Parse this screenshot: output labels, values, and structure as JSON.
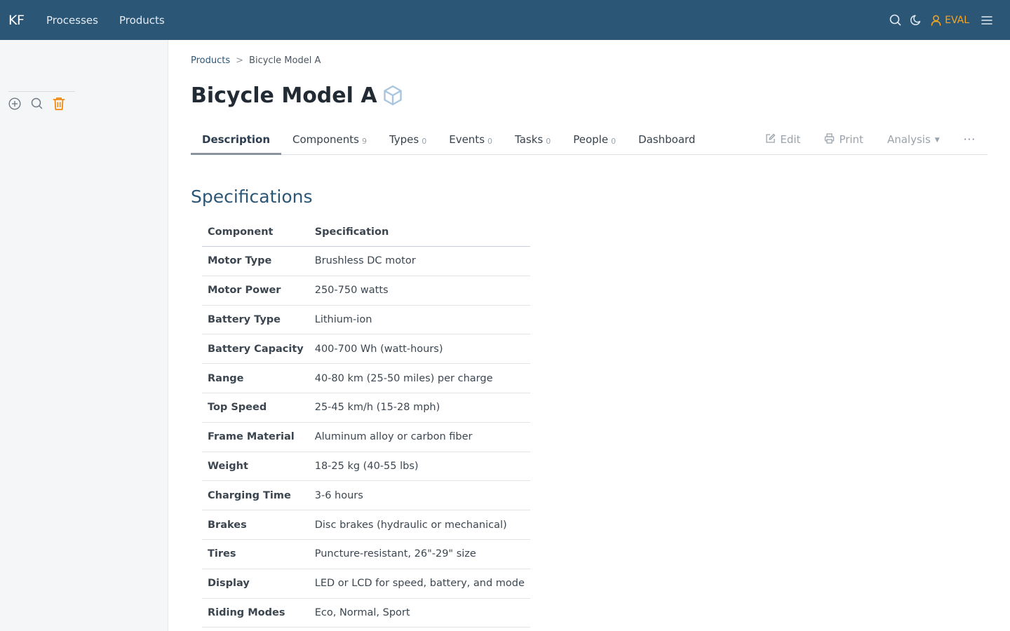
{
  "navbar": {
    "brand": "KF",
    "links": [
      "Processes",
      "Products"
    ],
    "user_label": "EVAL",
    "icons": [
      "search-icon",
      "moon-icon",
      "user-icon",
      "hamburger-icon"
    ],
    "color": "#2c5676",
    "user_color": "#f5a623"
  },
  "sidebar": {
    "buttons": [
      "add-circle-icon",
      "search-icon",
      "trash-icon"
    ]
  },
  "breadcrumb": {
    "parent": "Products",
    "separator": ">",
    "current": "Bicycle Model A"
  },
  "page": {
    "title": "Bicycle Model A",
    "title_icon": "cube-icon"
  },
  "tabs": [
    {
      "label": "Description",
      "count": ""
    },
    {
      "label": "Components",
      "count": "9"
    },
    {
      "label": "Types",
      "count": "0"
    },
    {
      "label": "Events",
      "count": "0"
    },
    {
      "label": "Tasks",
      "count": "0"
    },
    {
      "label": "People",
      "count": "0"
    },
    {
      "label": "Dashboard",
      "count": ""
    }
  ],
  "actions": {
    "edit": "Edit",
    "print": "Print",
    "analysis": "Analysis",
    "more": "···"
  },
  "specifications": {
    "heading": "Specifications",
    "columns": [
      "Component",
      "Specification"
    ],
    "rows": [
      {
        "component": "Motor Type",
        "spec": "Brushless DC motor"
      },
      {
        "component": "Motor Power",
        "spec": "250-750 watts"
      },
      {
        "component": "Battery Type",
        "spec": "Lithium-ion"
      },
      {
        "component": "Battery Capacity",
        "spec": "400-700 Wh (watt-hours)"
      },
      {
        "component": "Range",
        "spec": "40-80 km (25-50 miles) per charge"
      },
      {
        "component": "Top Speed",
        "spec": "25-45 km/h (15-28 mph)"
      },
      {
        "component": "Frame Material",
        "spec": "Aluminum alloy or carbon fiber"
      },
      {
        "component": "Weight",
        "spec": "18-25 kg (40-55 lbs)"
      },
      {
        "component": "Charging Time",
        "spec": "3-6 hours"
      },
      {
        "component": "Brakes",
        "spec": "Disc brakes (hydraulic or mechanical)"
      },
      {
        "component": "Tires",
        "spec": "Puncture-resistant, 26\"-29\" size"
      },
      {
        "component": "Display",
        "spec": "LED or LCD for speed, battery, and mode"
      },
      {
        "component": "Riding Modes",
        "spec": "Eco, Normal, Sport"
      }
    ]
  }
}
